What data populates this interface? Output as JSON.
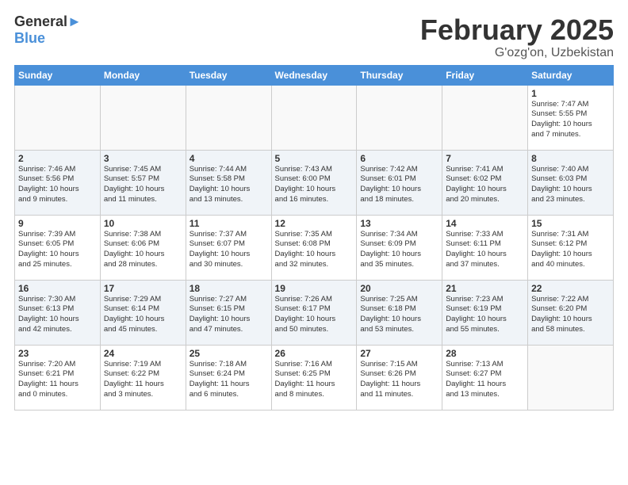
{
  "header": {
    "logo_line1": "General",
    "logo_line2": "Blue",
    "month": "February 2025",
    "location": "G'ozg'on, Uzbekistan"
  },
  "days_of_week": [
    "Sunday",
    "Monday",
    "Tuesday",
    "Wednesday",
    "Thursday",
    "Friday",
    "Saturday"
  ],
  "weeks": [
    [
      {
        "day": "",
        "info": ""
      },
      {
        "day": "",
        "info": ""
      },
      {
        "day": "",
        "info": ""
      },
      {
        "day": "",
        "info": ""
      },
      {
        "day": "",
        "info": ""
      },
      {
        "day": "",
        "info": ""
      },
      {
        "day": "1",
        "info": "Sunrise: 7:47 AM\nSunset: 5:55 PM\nDaylight: 10 hours\nand 7 minutes."
      }
    ],
    [
      {
        "day": "2",
        "info": "Sunrise: 7:46 AM\nSunset: 5:56 PM\nDaylight: 10 hours\nand 9 minutes."
      },
      {
        "day": "3",
        "info": "Sunrise: 7:45 AM\nSunset: 5:57 PM\nDaylight: 10 hours\nand 11 minutes."
      },
      {
        "day": "4",
        "info": "Sunrise: 7:44 AM\nSunset: 5:58 PM\nDaylight: 10 hours\nand 13 minutes."
      },
      {
        "day": "5",
        "info": "Sunrise: 7:43 AM\nSunset: 6:00 PM\nDaylight: 10 hours\nand 16 minutes."
      },
      {
        "day": "6",
        "info": "Sunrise: 7:42 AM\nSunset: 6:01 PM\nDaylight: 10 hours\nand 18 minutes."
      },
      {
        "day": "7",
        "info": "Sunrise: 7:41 AM\nSunset: 6:02 PM\nDaylight: 10 hours\nand 20 minutes."
      },
      {
        "day": "8",
        "info": "Sunrise: 7:40 AM\nSunset: 6:03 PM\nDaylight: 10 hours\nand 23 minutes."
      }
    ],
    [
      {
        "day": "9",
        "info": "Sunrise: 7:39 AM\nSunset: 6:05 PM\nDaylight: 10 hours\nand 25 minutes."
      },
      {
        "day": "10",
        "info": "Sunrise: 7:38 AM\nSunset: 6:06 PM\nDaylight: 10 hours\nand 28 minutes."
      },
      {
        "day": "11",
        "info": "Sunrise: 7:37 AM\nSunset: 6:07 PM\nDaylight: 10 hours\nand 30 minutes."
      },
      {
        "day": "12",
        "info": "Sunrise: 7:35 AM\nSunset: 6:08 PM\nDaylight: 10 hours\nand 32 minutes."
      },
      {
        "day": "13",
        "info": "Sunrise: 7:34 AM\nSunset: 6:09 PM\nDaylight: 10 hours\nand 35 minutes."
      },
      {
        "day": "14",
        "info": "Sunrise: 7:33 AM\nSunset: 6:11 PM\nDaylight: 10 hours\nand 37 minutes."
      },
      {
        "day": "15",
        "info": "Sunrise: 7:31 AM\nSunset: 6:12 PM\nDaylight: 10 hours\nand 40 minutes."
      }
    ],
    [
      {
        "day": "16",
        "info": "Sunrise: 7:30 AM\nSunset: 6:13 PM\nDaylight: 10 hours\nand 42 minutes."
      },
      {
        "day": "17",
        "info": "Sunrise: 7:29 AM\nSunset: 6:14 PM\nDaylight: 10 hours\nand 45 minutes."
      },
      {
        "day": "18",
        "info": "Sunrise: 7:27 AM\nSunset: 6:15 PM\nDaylight: 10 hours\nand 47 minutes."
      },
      {
        "day": "19",
        "info": "Sunrise: 7:26 AM\nSunset: 6:17 PM\nDaylight: 10 hours\nand 50 minutes."
      },
      {
        "day": "20",
        "info": "Sunrise: 7:25 AM\nSunset: 6:18 PM\nDaylight: 10 hours\nand 53 minutes."
      },
      {
        "day": "21",
        "info": "Sunrise: 7:23 AM\nSunset: 6:19 PM\nDaylight: 10 hours\nand 55 minutes."
      },
      {
        "day": "22",
        "info": "Sunrise: 7:22 AM\nSunset: 6:20 PM\nDaylight: 10 hours\nand 58 minutes."
      }
    ],
    [
      {
        "day": "23",
        "info": "Sunrise: 7:20 AM\nSunset: 6:21 PM\nDaylight: 11 hours\nand 0 minutes."
      },
      {
        "day": "24",
        "info": "Sunrise: 7:19 AM\nSunset: 6:22 PM\nDaylight: 11 hours\nand 3 minutes."
      },
      {
        "day": "25",
        "info": "Sunrise: 7:18 AM\nSunset: 6:24 PM\nDaylight: 11 hours\nand 6 minutes."
      },
      {
        "day": "26",
        "info": "Sunrise: 7:16 AM\nSunset: 6:25 PM\nDaylight: 11 hours\nand 8 minutes."
      },
      {
        "day": "27",
        "info": "Sunrise: 7:15 AM\nSunset: 6:26 PM\nDaylight: 11 hours\nand 11 minutes."
      },
      {
        "day": "28",
        "info": "Sunrise: 7:13 AM\nSunset: 6:27 PM\nDaylight: 11 hours\nand 13 minutes."
      },
      {
        "day": "",
        "info": ""
      }
    ]
  ]
}
